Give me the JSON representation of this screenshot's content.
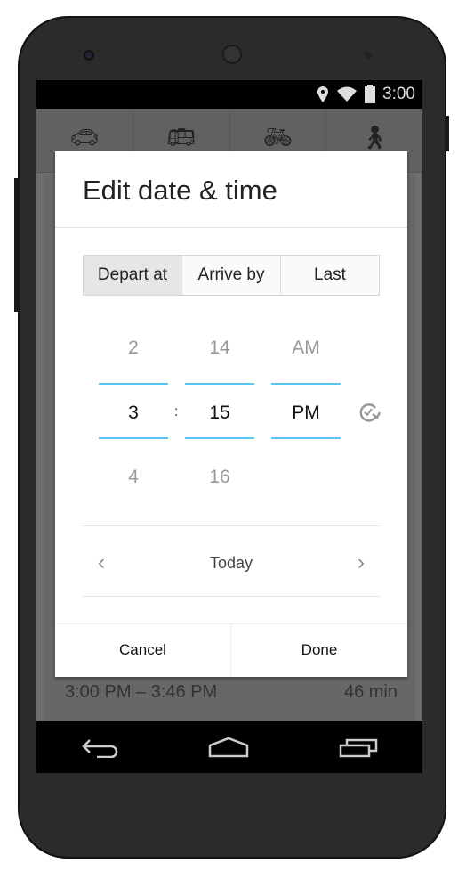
{
  "status_bar": {
    "time": "3:00",
    "icons": [
      "location-icon",
      "wifi-icon",
      "battery-icon"
    ]
  },
  "travel_modes": [
    {
      "name": "car-icon"
    },
    {
      "name": "transit-icon"
    },
    {
      "name": "bike-icon"
    },
    {
      "name": "walk-icon"
    }
  ],
  "background_trip": {
    "time_range": "3:00 PM – 3:46 PM",
    "duration": "46 min"
  },
  "dialog": {
    "title": "Edit date & time",
    "segments": [
      {
        "label": "Depart at",
        "selected": true
      },
      {
        "label": "Arrive by",
        "selected": false
      },
      {
        "label": "Last",
        "selected": false
      }
    ],
    "hour": {
      "prev": "2",
      "current": "3",
      "next": "4"
    },
    "separator": ":",
    "minute": {
      "prev": "14",
      "current": "15",
      "next": "16"
    },
    "ampm": {
      "prev": "AM",
      "current": "PM"
    },
    "date": "Today",
    "cancel_label": "Cancel",
    "done_label": "Done",
    "accent_color": "#58c6ee"
  }
}
